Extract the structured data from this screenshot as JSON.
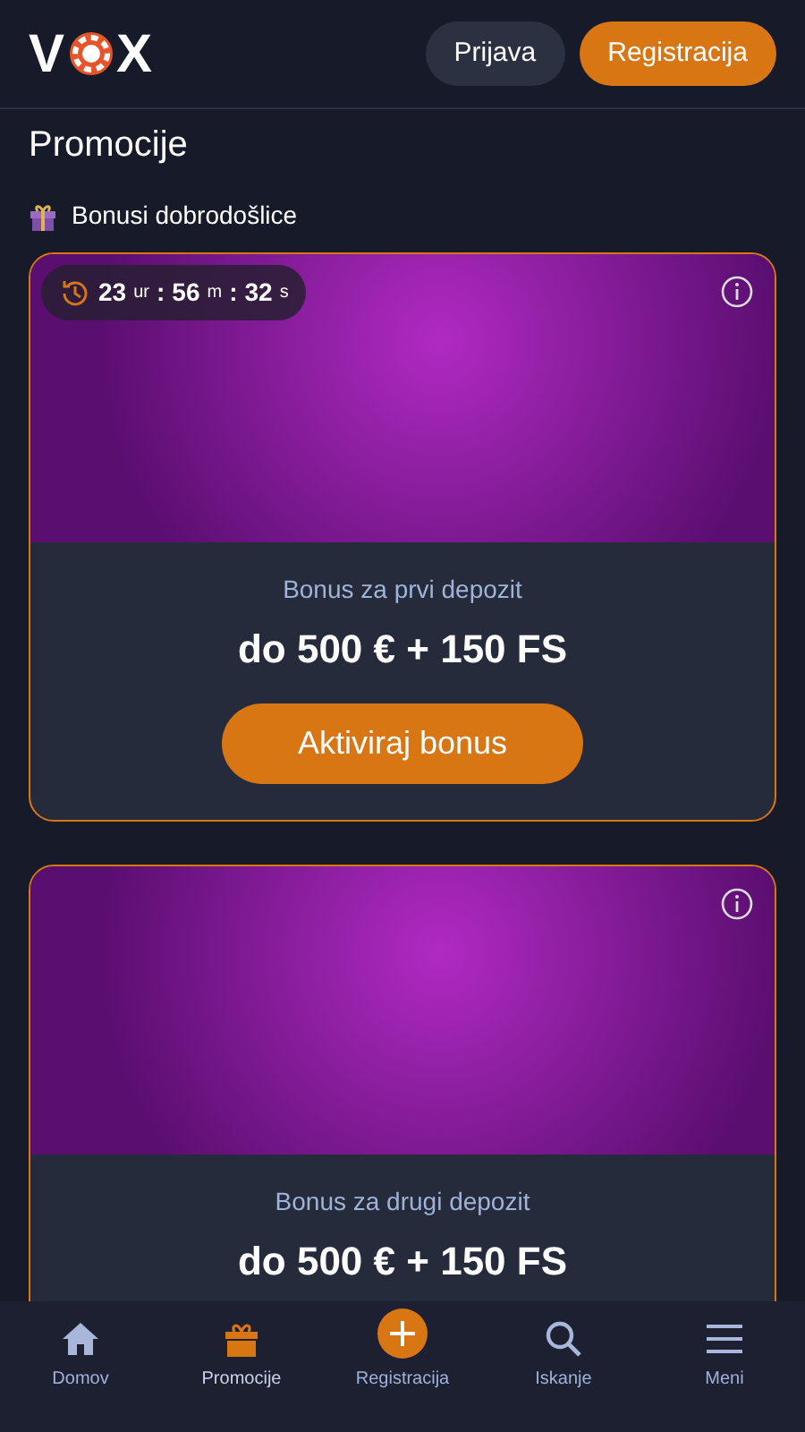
{
  "header": {
    "logo_start": "V",
    "logo_end": "X",
    "login_button": "Prijava",
    "register_button": "Registracija"
  },
  "page_title": "Promocije",
  "section": {
    "title": "Bonusi dobrodošlice"
  },
  "promos": [
    {
      "timer": [
        {
          "value": "23",
          "unit": "ur",
          "separator": ":"
        },
        {
          "value": "56",
          "unit": "m",
          "separator": ":"
        },
        {
          "value": "32",
          "unit": "s"
        }
      ],
      "subtitle": "Bonus za prvi depozit",
      "amount": "do 500 € + 150 FS",
      "button": "Aktiviraj bonus"
    },
    {
      "subtitle": "Bonus za drugi depozit",
      "amount": "do 500 € + 150 FS"
    }
  ],
  "bottom_nav": [
    {
      "kind": "home",
      "label": "Domov",
      "selected": false
    },
    {
      "kind": "gift",
      "label": "Promocije",
      "selected": true
    },
    {
      "kind": "plus",
      "label": "Registracija",
      "selected": false
    },
    {
      "kind": "search",
      "label": "Iskanje",
      "selected": false
    },
    {
      "kind": "menu",
      "label": "Meni",
      "selected": false
    }
  ]
}
